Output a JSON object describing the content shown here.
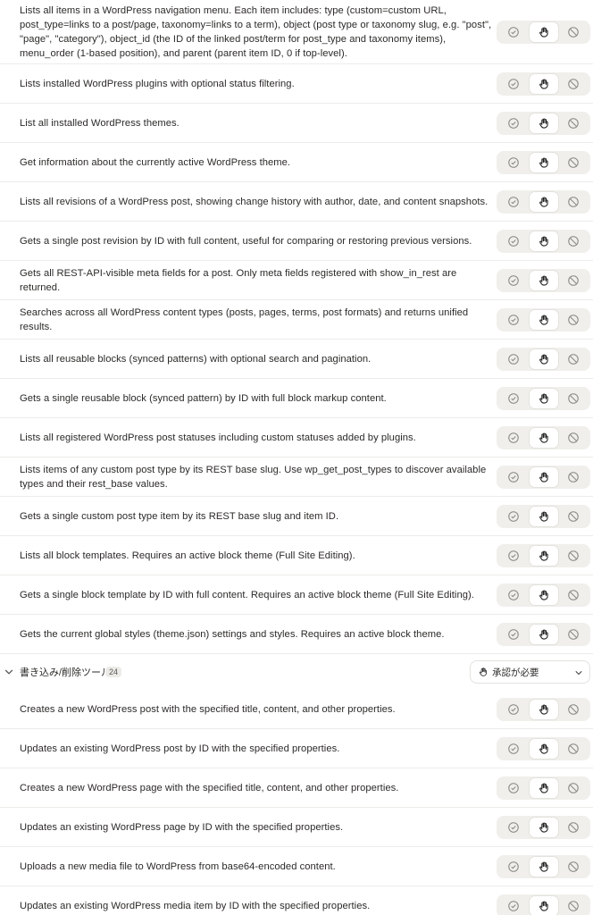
{
  "permission_options": {
    "auto_allow": "check-circle-icon",
    "needs_approval": "hand-icon",
    "blocked": "block-icon"
  },
  "read_tools_tail": [
    {
      "text": "Lists all items in a WordPress navigation menu. Each item includes: type (custom=custom URL, post_type=links to a post/page, taxonomy=links to a term), object (post type or taxonomy slug, e.g. \"post\", \"page\", \"category\"), object_id (the ID of the linked post/term for post_type and taxonomy items), menu_order (1-based position), and parent (parent item ID, 0 if top-level).",
      "selected": "needs_approval"
    },
    {
      "text": "Lists installed WordPress plugins with optional status filtering.",
      "selected": "needs_approval"
    },
    {
      "text": "List all installed WordPress themes.",
      "selected": "needs_approval"
    },
    {
      "text": "Get information about the currently active WordPress theme.",
      "selected": "needs_approval"
    },
    {
      "text": "Lists all revisions of a WordPress post, showing change history with author, date, and content snapshots.",
      "selected": "needs_approval"
    },
    {
      "text": "Gets a single post revision by ID with full content, useful for comparing or restoring previous versions.",
      "selected": "needs_approval"
    },
    {
      "text": "Gets all REST-API-visible meta fields for a post. Only meta fields registered with show_in_rest are returned.",
      "selected": "needs_approval"
    },
    {
      "text": "Searches across all WordPress content types (posts, pages, terms, post formats) and returns unified results.",
      "selected": "needs_approval"
    },
    {
      "text": "Lists all reusable blocks (synced patterns) with optional search and pagination.",
      "selected": "needs_approval"
    },
    {
      "text": "Gets a single reusable block (synced pattern) by ID with full block markup content.",
      "selected": "needs_approval"
    },
    {
      "text": "Lists all registered WordPress post statuses including custom statuses added by plugins.",
      "selected": "needs_approval"
    },
    {
      "text": "Lists items of any custom post type by its REST base slug. Use wp_get_post_types to discover available types and their rest_base values.",
      "selected": "needs_approval"
    },
    {
      "text": "Gets a single custom post type item by its REST base slug and item ID.",
      "selected": "needs_approval"
    },
    {
      "text": "Lists all block templates. Requires an active block theme (Full Site Editing).",
      "selected": "needs_approval"
    },
    {
      "text": "Gets a single block template by ID with full content. Requires an active block theme (Full Site Editing).",
      "selected": "needs_approval"
    },
    {
      "text": "Gets the current global styles (theme.json) settings and styles. Requires an active block theme.",
      "selected": "needs_approval"
    }
  ],
  "write_section": {
    "title": "書き込み/削除ツール",
    "count": "24",
    "policy_label": "承認が必要",
    "policy_icon": "hand-icon"
  },
  "write_tools": [
    {
      "text": "Creates a new WordPress post with the specified title, content, and other properties.",
      "selected": "needs_approval"
    },
    {
      "text": "Updates an existing WordPress post by ID with the specified properties.",
      "selected": "needs_approval"
    },
    {
      "text": "Creates a new WordPress page with the specified title, content, and other properties.",
      "selected": "needs_approval"
    },
    {
      "text": "Updates an existing WordPress page by ID with the specified properties.",
      "selected": "needs_approval"
    },
    {
      "text": "Uploads a new media file to WordPress from base64-encoded content.",
      "selected": "needs_approval"
    },
    {
      "text": "Updates an existing WordPress media item by ID with the specified properties.",
      "selected": "needs_approval"
    }
  ]
}
